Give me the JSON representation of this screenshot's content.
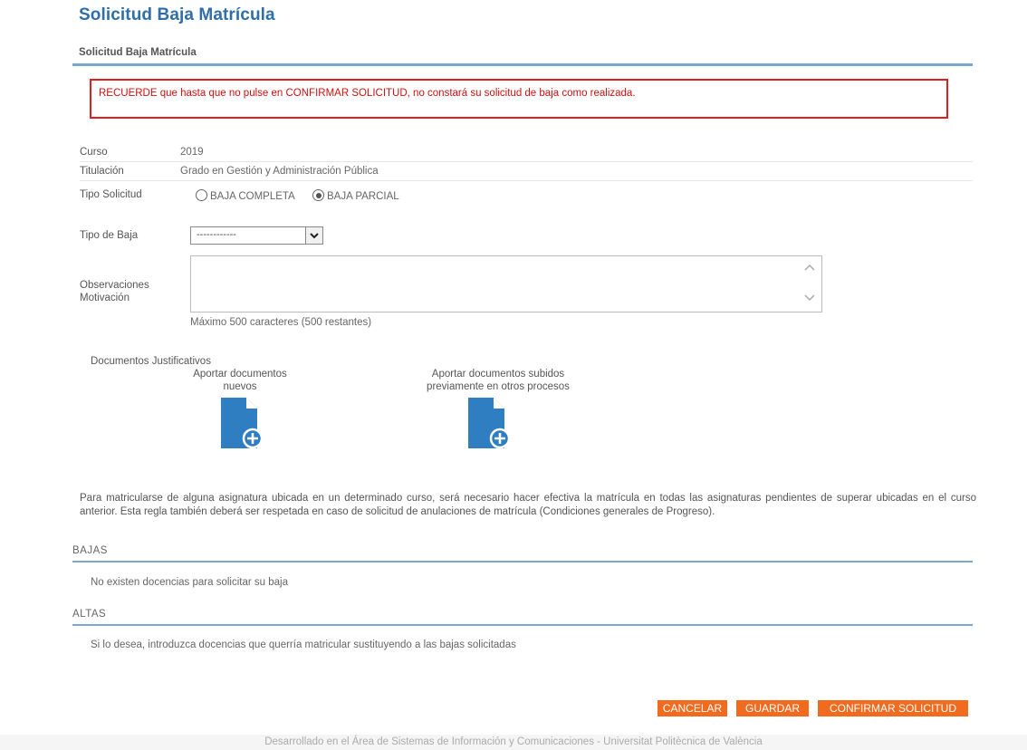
{
  "page": {
    "title": "Solicitud Baja Matrícula"
  },
  "section": {
    "title": "Solicitud Baja Matrícula"
  },
  "alert": {
    "text": "RECUERDE que hasta que no pulse en CONFIRMAR SOLICITUD, no constará su solicitud de baja como realizada."
  },
  "form": {
    "curso_label": "Curso",
    "curso_value": "2019",
    "titulacion_label": "Titulación",
    "titulacion_value": "Grado en Gestión y Administración Pública",
    "tipo_solicitud_label": "Tipo Solicitud",
    "tipo_solicitud_options": [
      {
        "label": "BAJA COMPLETA",
        "selected": false
      },
      {
        "label": "BAJA PARCIAL",
        "selected": true
      }
    ],
    "tipo_baja_label": "Tipo de Baja",
    "tipo_baja_value": "------------",
    "observaciones_label_1": "Observaciones",
    "observaciones_label_2": "Motivación",
    "observaciones_value": "",
    "char_counter": "Máximo 500 caracteres (500 restantes)"
  },
  "documents": {
    "title": "Documentos Justificativos",
    "new_label_1": "Aportar documentos",
    "new_label_2": "nuevos",
    "previous_label_1": "Aportar documentos subidos",
    "previous_label_2": "previamente en otros procesos",
    "icon": "document-add-icon",
    "icon_color": "#2f7ec1"
  },
  "note": {
    "text": "Para matricularse de alguna asignatura ubicada en un determinado curso, será necesario hacer efectiva la matrícula en todas las asignaturas pendientes de superar ubicadas en el curso anterior. Esta regla también deberá ser respetada en caso de solicitud de anulaciones de matrícula (Condiciones generales de Progreso)."
  },
  "bajas": {
    "title": "BAJAS",
    "text": "No existen docencias para solicitar su baja"
  },
  "altas": {
    "title": "ALTAS",
    "text": "Si lo desea, introduzca docencias que querría matricular sustituyendo a las bajas solicitadas"
  },
  "buttons": {
    "cancel": "CANCELAR",
    "save": "GUARDAR",
    "confirm": "CONFIRMAR SOLICITUD"
  },
  "footer": {
    "text": "Desarrollado en el Área de Sistemas de Información y Comunicaciones - Universitat Politècnica de València"
  },
  "colors": {
    "accent": "#2f6ea7",
    "alert": "#e01e1e",
    "button": "#f16b1f",
    "divider": "#7aa7cf"
  }
}
